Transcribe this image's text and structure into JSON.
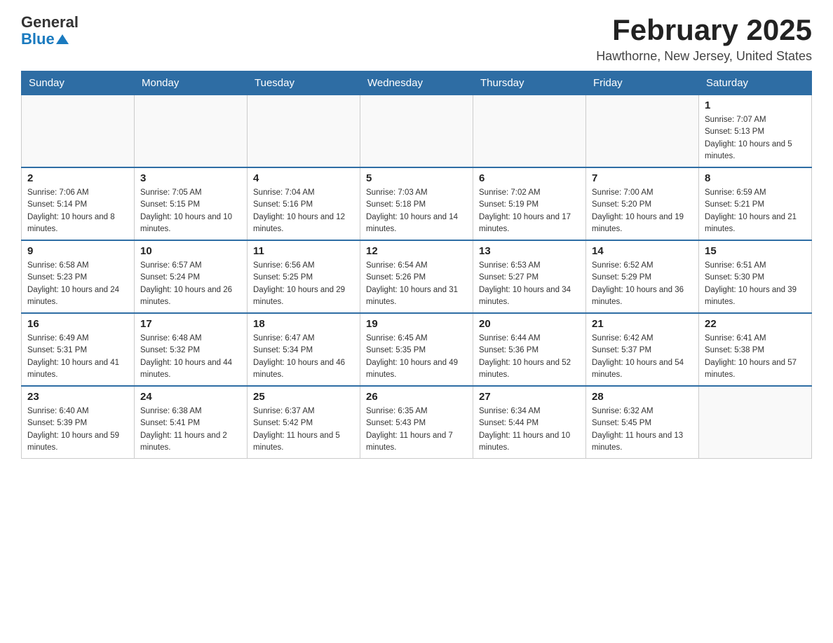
{
  "header": {
    "logo_general": "General",
    "logo_blue": "Blue",
    "month_title": "February 2025",
    "location": "Hawthorne, New Jersey, United States"
  },
  "days_of_week": [
    "Sunday",
    "Monday",
    "Tuesday",
    "Wednesday",
    "Thursday",
    "Friday",
    "Saturday"
  ],
  "weeks": [
    [
      {
        "day": "",
        "info": ""
      },
      {
        "day": "",
        "info": ""
      },
      {
        "day": "",
        "info": ""
      },
      {
        "day": "",
        "info": ""
      },
      {
        "day": "",
        "info": ""
      },
      {
        "day": "",
        "info": ""
      },
      {
        "day": "1",
        "info": "Sunrise: 7:07 AM\nSunset: 5:13 PM\nDaylight: 10 hours and 5 minutes."
      }
    ],
    [
      {
        "day": "2",
        "info": "Sunrise: 7:06 AM\nSunset: 5:14 PM\nDaylight: 10 hours and 8 minutes."
      },
      {
        "day": "3",
        "info": "Sunrise: 7:05 AM\nSunset: 5:15 PM\nDaylight: 10 hours and 10 minutes."
      },
      {
        "day": "4",
        "info": "Sunrise: 7:04 AM\nSunset: 5:16 PM\nDaylight: 10 hours and 12 minutes."
      },
      {
        "day": "5",
        "info": "Sunrise: 7:03 AM\nSunset: 5:18 PM\nDaylight: 10 hours and 14 minutes."
      },
      {
        "day": "6",
        "info": "Sunrise: 7:02 AM\nSunset: 5:19 PM\nDaylight: 10 hours and 17 minutes."
      },
      {
        "day": "7",
        "info": "Sunrise: 7:00 AM\nSunset: 5:20 PM\nDaylight: 10 hours and 19 minutes."
      },
      {
        "day": "8",
        "info": "Sunrise: 6:59 AM\nSunset: 5:21 PM\nDaylight: 10 hours and 21 minutes."
      }
    ],
    [
      {
        "day": "9",
        "info": "Sunrise: 6:58 AM\nSunset: 5:23 PM\nDaylight: 10 hours and 24 minutes."
      },
      {
        "day": "10",
        "info": "Sunrise: 6:57 AM\nSunset: 5:24 PM\nDaylight: 10 hours and 26 minutes."
      },
      {
        "day": "11",
        "info": "Sunrise: 6:56 AM\nSunset: 5:25 PM\nDaylight: 10 hours and 29 minutes."
      },
      {
        "day": "12",
        "info": "Sunrise: 6:54 AM\nSunset: 5:26 PM\nDaylight: 10 hours and 31 minutes."
      },
      {
        "day": "13",
        "info": "Sunrise: 6:53 AM\nSunset: 5:27 PM\nDaylight: 10 hours and 34 minutes."
      },
      {
        "day": "14",
        "info": "Sunrise: 6:52 AM\nSunset: 5:29 PM\nDaylight: 10 hours and 36 minutes."
      },
      {
        "day": "15",
        "info": "Sunrise: 6:51 AM\nSunset: 5:30 PM\nDaylight: 10 hours and 39 minutes."
      }
    ],
    [
      {
        "day": "16",
        "info": "Sunrise: 6:49 AM\nSunset: 5:31 PM\nDaylight: 10 hours and 41 minutes."
      },
      {
        "day": "17",
        "info": "Sunrise: 6:48 AM\nSunset: 5:32 PM\nDaylight: 10 hours and 44 minutes."
      },
      {
        "day": "18",
        "info": "Sunrise: 6:47 AM\nSunset: 5:34 PM\nDaylight: 10 hours and 46 minutes."
      },
      {
        "day": "19",
        "info": "Sunrise: 6:45 AM\nSunset: 5:35 PM\nDaylight: 10 hours and 49 minutes."
      },
      {
        "day": "20",
        "info": "Sunrise: 6:44 AM\nSunset: 5:36 PM\nDaylight: 10 hours and 52 minutes."
      },
      {
        "day": "21",
        "info": "Sunrise: 6:42 AM\nSunset: 5:37 PM\nDaylight: 10 hours and 54 minutes."
      },
      {
        "day": "22",
        "info": "Sunrise: 6:41 AM\nSunset: 5:38 PM\nDaylight: 10 hours and 57 minutes."
      }
    ],
    [
      {
        "day": "23",
        "info": "Sunrise: 6:40 AM\nSunset: 5:39 PM\nDaylight: 10 hours and 59 minutes."
      },
      {
        "day": "24",
        "info": "Sunrise: 6:38 AM\nSunset: 5:41 PM\nDaylight: 11 hours and 2 minutes."
      },
      {
        "day": "25",
        "info": "Sunrise: 6:37 AM\nSunset: 5:42 PM\nDaylight: 11 hours and 5 minutes."
      },
      {
        "day": "26",
        "info": "Sunrise: 6:35 AM\nSunset: 5:43 PM\nDaylight: 11 hours and 7 minutes."
      },
      {
        "day": "27",
        "info": "Sunrise: 6:34 AM\nSunset: 5:44 PM\nDaylight: 11 hours and 10 minutes."
      },
      {
        "day": "28",
        "info": "Sunrise: 6:32 AM\nSunset: 5:45 PM\nDaylight: 11 hours and 13 minutes."
      },
      {
        "day": "",
        "info": ""
      }
    ]
  ]
}
